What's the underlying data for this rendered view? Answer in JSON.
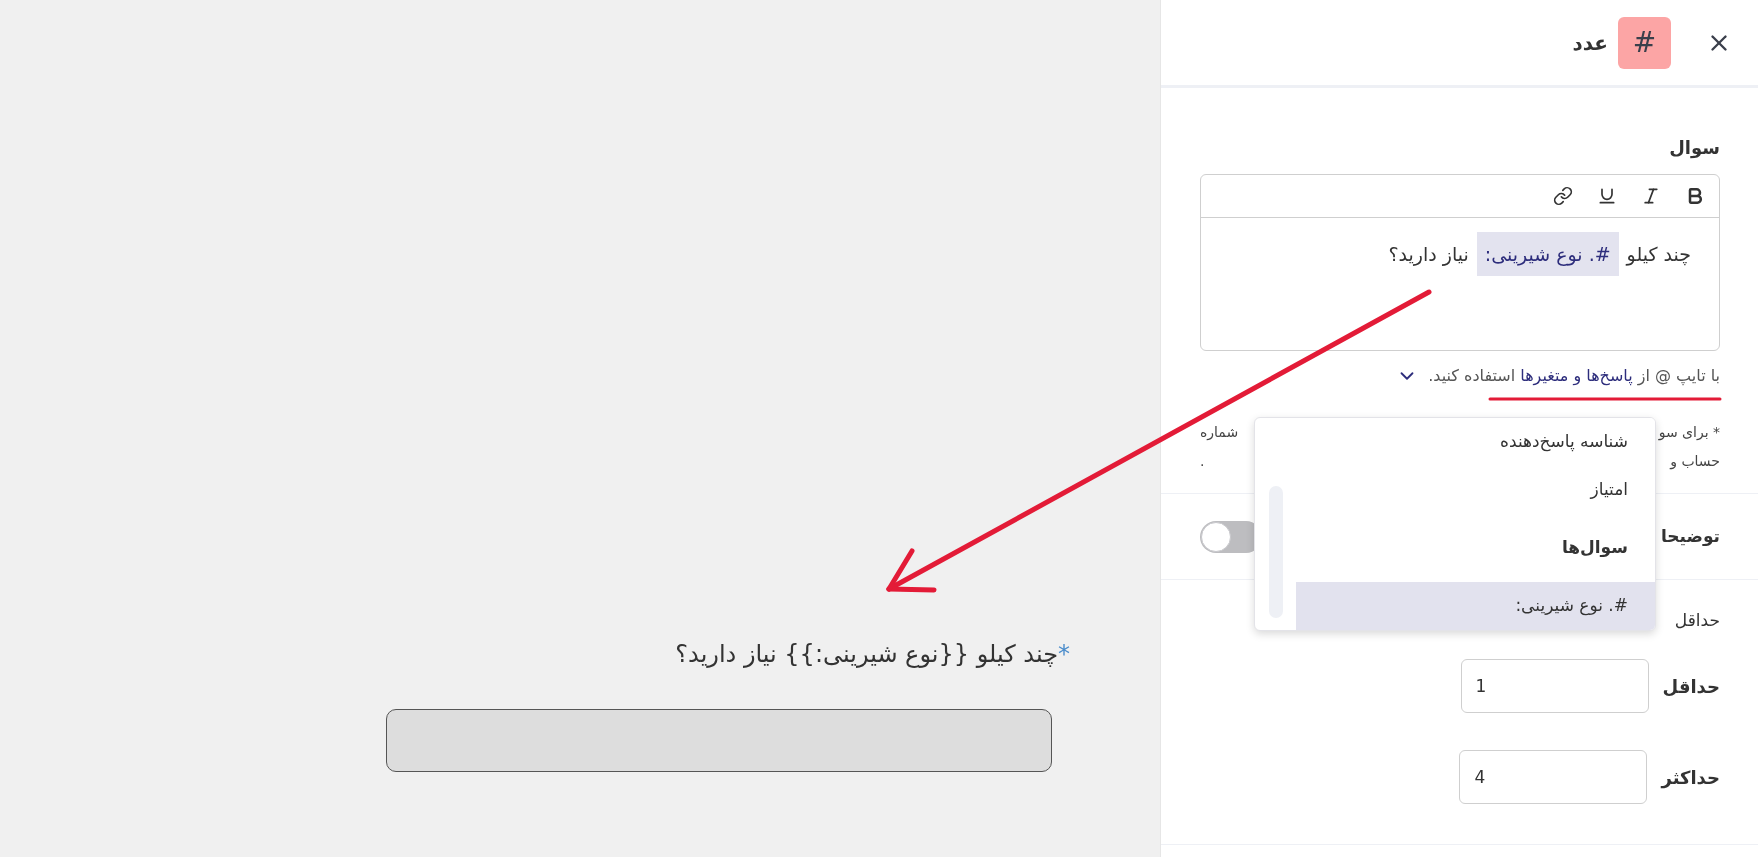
{
  "preview": {
    "required_mark": "*",
    "question": "چند کیلو {{نوع شیرینی:}} نیاز دارید؟",
    "answer_field": {
      "disabled": true
    }
  },
  "panel": {
    "header": {
      "type_badge": "#",
      "title": "عدد"
    },
    "question_section": {
      "label": "سوال",
      "toolbar": [
        {
          "kind": "bold"
        },
        {
          "kind": "italic"
        },
        {
          "kind": "underline"
        },
        {
          "kind": "link"
        }
      ],
      "content": [
        {
          "kind": "text",
          "text": "چند کیلو"
        },
        {
          "kind": "variable",
          "text": "#. نوع شیرینی:"
        },
        {
          "kind": "text",
          "text": "نیاز دارید؟"
        }
      ],
      "hint": [
        {
          "kind": "text",
          "text": "با تایپ @ از"
        },
        {
          "kind": "link",
          "text": "پاسخ‌ها و متغیرها"
        },
        {
          "kind": "text",
          "text": "استفاده کنید."
        }
      ],
      "note_lines": [
        {
          "start": "* برای سو",
          "end": "شماره"
        },
        {
          "start": "حساب و",
          "end": "."
        }
      ]
    },
    "description": {
      "label": "توضیحا",
      "on": false
    },
    "range": {
      "caption": "حداقل",
      "fields": [
        {
          "label": "حداقل",
          "value": "1"
        },
        {
          "label": "حداکثر",
          "value": "4"
        }
      ]
    },
    "variable_menu": {
      "items": [
        {
          "kind": "option",
          "label": "شناسه پاسخ‌دهنده",
          "selected": false
        },
        {
          "kind": "option",
          "label": "امتیاز",
          "selected": false
        },
        {
          "kind": "group",
          "label": "سوال‌ها"
        },
        {
          "kind": "option",
          "label": "#. نوع شیرینی:",
          "selected": true
        }
      ]
    }
  }
}
